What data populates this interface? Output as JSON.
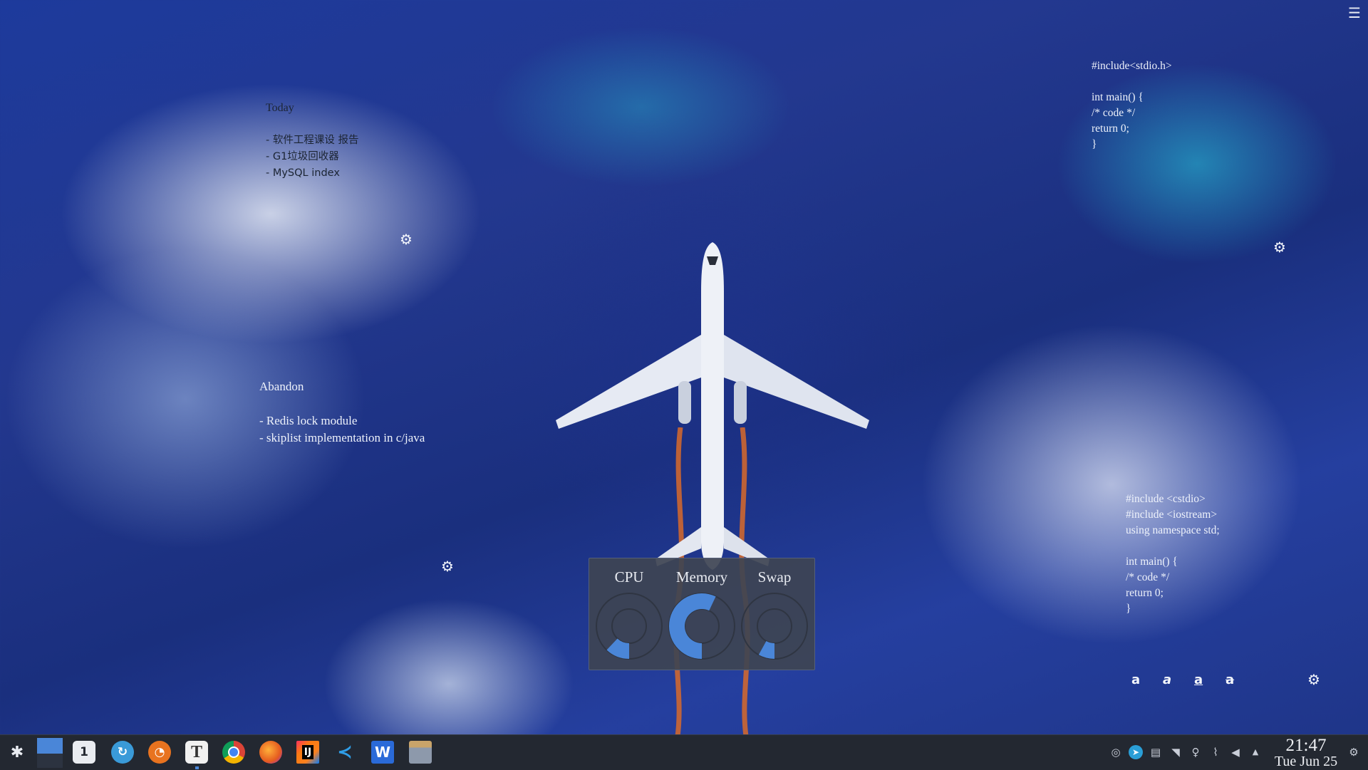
{
  "desktop": {
    "note_today": {
      "title": "Today",
      "items": [
        "- 软件工程课设 报告",
        "- G1垃圾回收器",
        "- MySQL index"
      ]
    },
    "note_abandon": {
      "title": "Abandon",
      "items": [
        "- Redis lock module",
        "- skiplist implementation in c/java"
      ]
    },
    "note_code1": {
      "lines": [
        "#include<stdio.h>",
        "",
        "int main() {",
        "/* code */",
        "return 0;",
        "}"
      ]
    },
    "note_code2": {
      "lines": [
        "#include <cstdio>",
        "#include <iostream>",
        "using namespace std;",
        "",
        "int main() {",
        "/* code */",
        "return 0;",
        "}"
      ]
    },
    "font_buttons": [
      "a",
      "a",
      "a",
      "a"
    ]
  },
  "system_monitor": {
    "gauges": [
      {
        "label": "CPU",
        "percent": 12
      },
      {
        "label": "Memory",
        "percent": 57
      },
      {
        "label": "Swap",
        "percent": 8
      }
    ],
    "accent_color": "#4a86d8"
  },
  "taskbar": {
    "launchers": [
      "application-launcher-icon",
      "virtual-desktop-pager",
      "software-updater-icon",
      "sync-client-icon",
      "orange-app-icon",
      "typora-icon",
      "chrome-icon",
      "firefox-icon",
      "intellij-idea-icon",
      "vscode-icon",
      "wps-writer-icon",
      "file-manager-icon"
    ],
    "launcher_letters": {
      "typora": "T",
      "idea": "IJ",
      "wps": "W",
      "updater": "1"
    },
    "tray_icons": [
      "sync-status-icon",
      "telegram-icon",
      "clipboard-icon",
      "wifi-icon",
      "kde-connect-icon",
      "attachment-icon",
      "volume-icon",
      "expand-tray-icon"
    ],
    "clock": {
      "time": "21:47",
      "date": "Tue Jun 25"
    }
  }
}
